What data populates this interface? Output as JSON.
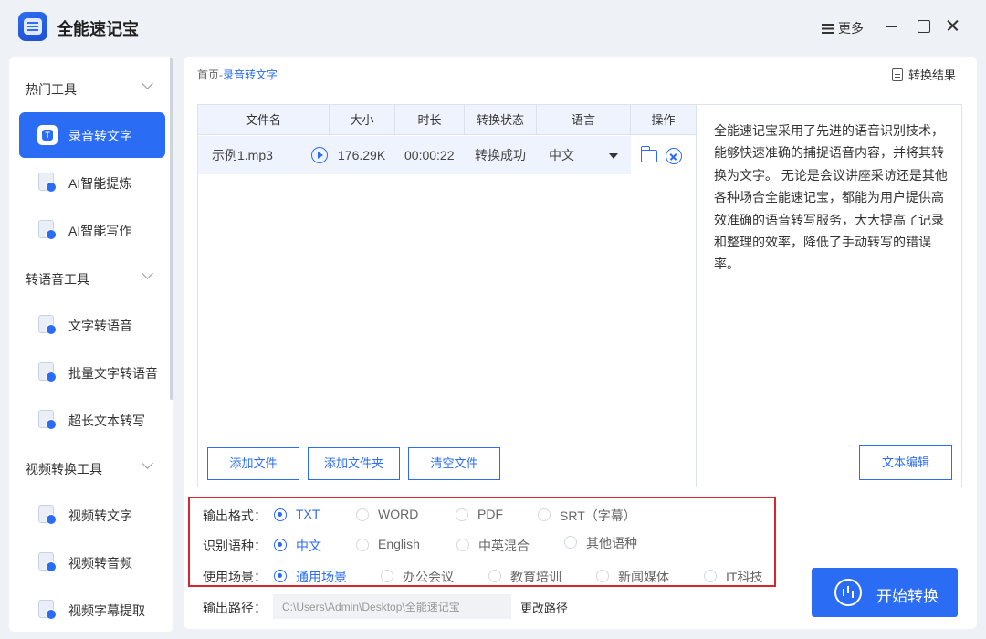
{
  "app": {
    "title": "全能速记宝"
  },
  "titlebar": {
    "more_label": "更多"
  },
  "sidebar": {
    "sections": [
      {
        "title": "热门工具",
        "items": [
          {
            "label": "录音转文字",
            "active": true
          },
          {
            "label": "AI智能提炼"
          },
          {
            "label": "AI智能写作"
          }
        ]
      },
      {
        "title": "转语音工具",
        "items": [
          {
            "label": "文字转语音"
          },
          {
            "label": "批量文字转语音"
          },
          {
            "label": "超长文本转写"
          }
        ]
      },
      {
        "title": "视频转换工具",
        "items": [
          {
            "label": "视频转文字"
          },
          {
            "label": "视频转音频"
          },
          {
            "label": "视频字幕提取"
          }
        ]
      }
    ]
  },
  "breadcrumb": {
    "home": "首页",
    "sep": "-",
    "current": "录音转文字"
  },
  "result_link": "转换结果",
  "table": {
    "headers": [
      "文件名",
      "大小",
      "时长",
      "转换状态",
      "语言",
      "操作"
    ],
    "rows": [
      {
        "name": "示例1.mp3",
        "size": "176.29K",
        "duration": "00:00:22",
        "status": "转换成功",
        "language": "中文"
      }
    ]
  },
  "buttons": {
    "add_file": "添加文件",
    "add_folder": "添加文件夹",
    "clear_files": "清空文件",
    "text_edit": "文本编辑",
    "start": "开始转换",
    "change_path": "更改路径"
  },
  "description": "全能速记宝采用了先进的语音识别技术，能够快速准确的捕捉语音内容，并将其转换为文字。 无论是会议讲座采访还是其他各种场合全能速记宝，都能为用户提供高效准确的语音转写服务，大大提高了记录和整理的效率，降低了手动转写的错误率。",
  "options": {
    "format": {
      "label": "输出格式：",
      "choices": [
        "TXT",
        "WORD",
        "PDF",
        "SRT（字幕）"
      ],
      "selected": "TXT"
    },
    "language": {
      "label": "识别语种：",
      "choices": [
        "中文",
        "English",
        "中英混合",
        "其他语种"
      ],
      "selected": "中文"
    },
    "scene": {
      "label": "使用场景：",
      "choices": [
        "通用场景",
        "办公会议",
        "教育培训",
        "新闻媒体",
        "IT科技"
      ],
      "selected": "通用场景"
    }
  },
  "output": {
    "label": "输出路径：",
    "path": "C:\\Users\\Admin\\Desktop\\全能速记宝"
  },
  "colors": {
    "accent": "#2b6cf5",
    "highlight_border": "#d9262a",
    "panel_bg": "#eef1f6"
  }
}
